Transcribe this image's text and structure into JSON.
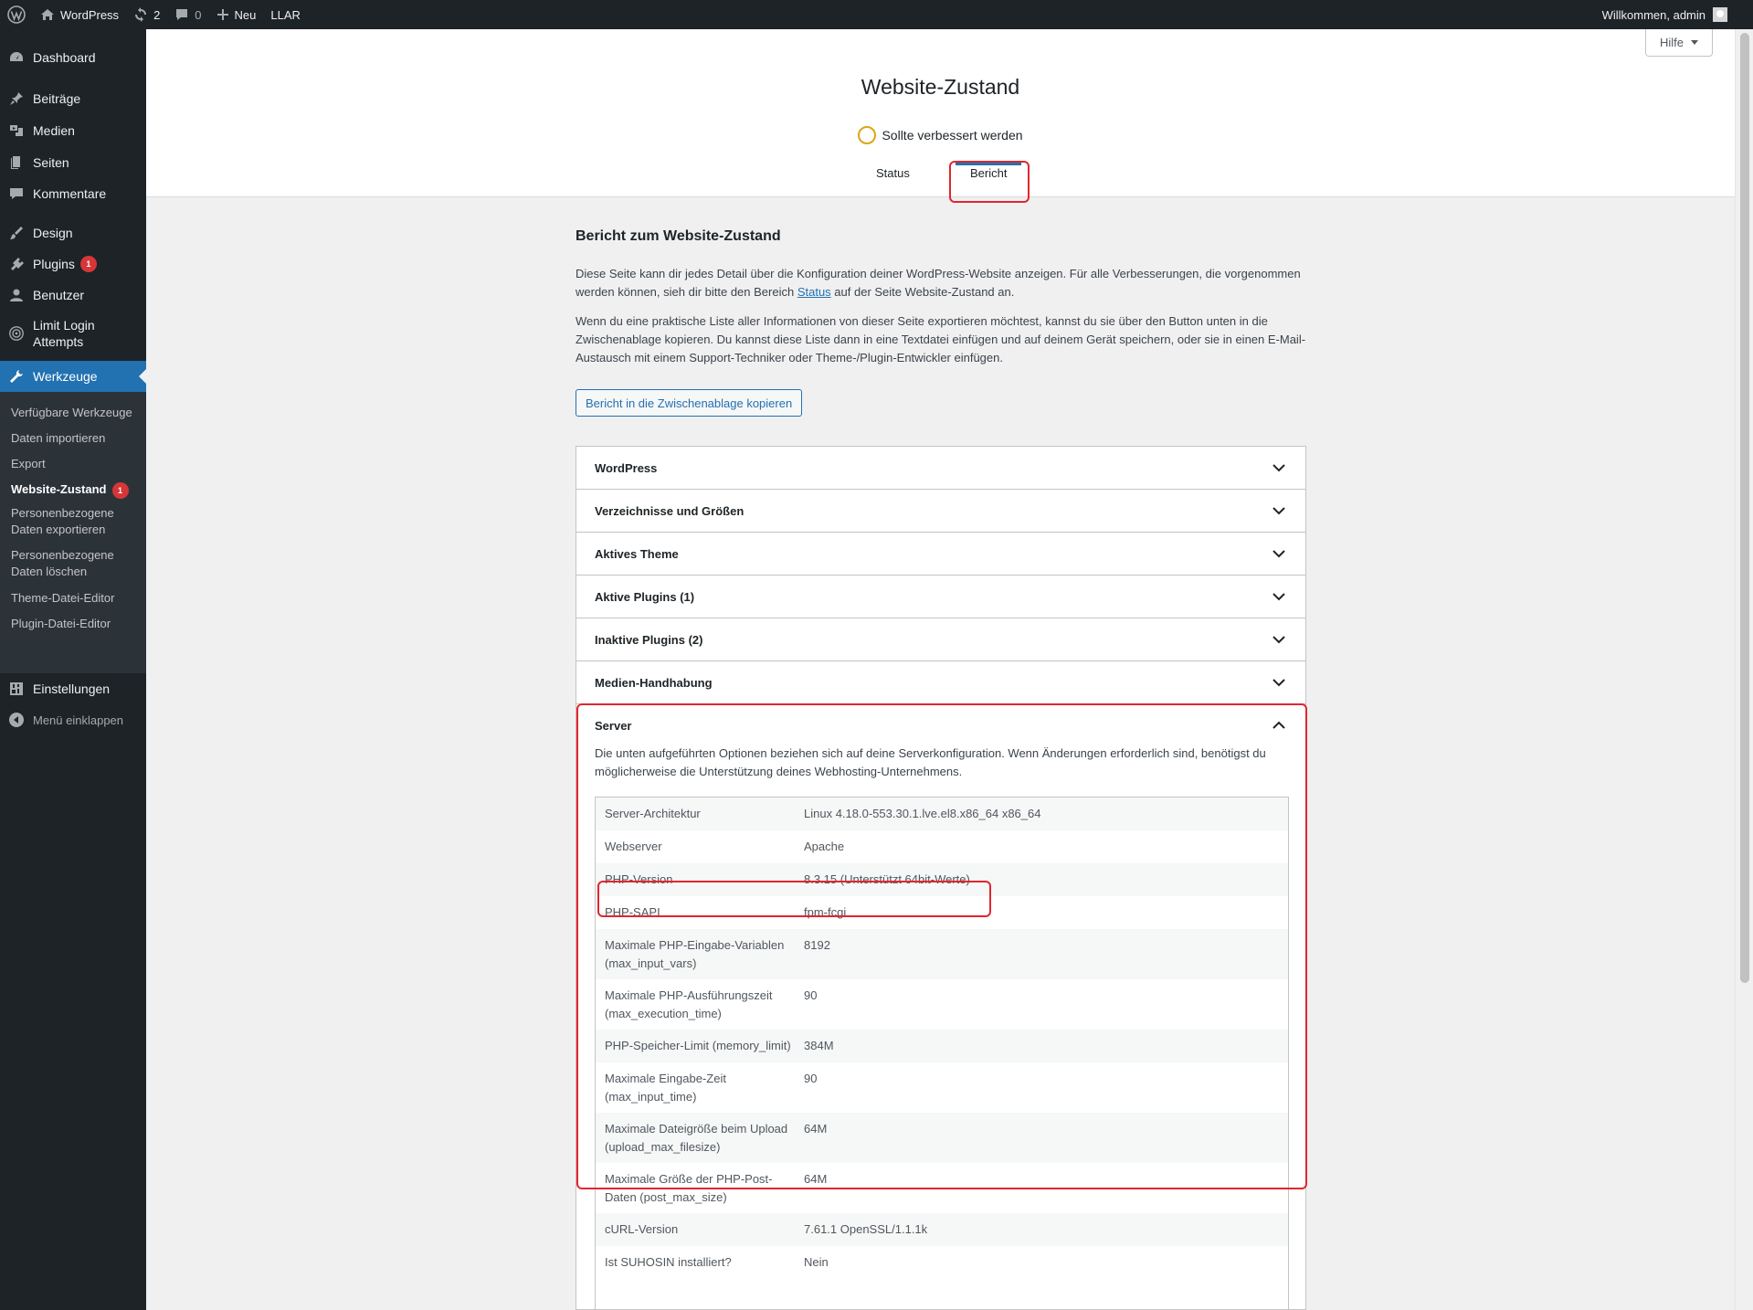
{
  "adminbar": {
    "site_name": "WordPress",
    "updates_count": "2",
    "comments_count": "0",
    "new_label": "Neu",
    "llar_label": "LLAR",
    "welcome": "Willkommen, admin"
  },
  "sidebar": {
    "items": [
      {
        "label": "Dashboard",
        "icon": "dashboard-icon"
      },
      {
        "label": "Beiträge",
        "icon": "pin-icon"
      },
      {
        "label": "Medien",
        "icon": "media-icon"
      },
      {
        "label": "Seiten",
        "icon": "pages-icon"
      },
      {
        "label": "Kommentare",
        "icon": "comment-icon"
      },
      {
        "label": "Design",
        "icon": "brush-icon"
      },
      {
        "label": "Plugins",
        "icon": "plugin-icon",
        "badge": "1"
      },
      {
        "label": "Benutzer",
        "icon": "user-icon"
      },
      {
        "label": "Limit Login",
        "label2": "Attempts",
        "icon": "llar-icon"
      },
      {
        "label": "Werkzeuge",
        "icon": "wrench-icon"
      },
      {
        "label": "Einstellungen",
        "icon": "settings-icon"
      },
      {
        "label": "Menü einklappen",
        "icon": "collapse-icon"
      }
    ],
    "submenu": [
      {
        "label": "Verfügbare Werkzeuge"
      },
      {
        "label": "Daten importieren"
      },
      {
        "label": "Export"
      },
      {
        "label": "Website-Zustand",
        "badge": "1"
      },
      {
        "label": "Personenbezogene",
        "label2": "Daten exportieren"
      },
      {
        "label": "Personenbezogene",
        "label2": "Daten löschen"
      },
      {
        "label": "Theme-Datei-Editor"
      },
      {
        "label": "Plugin-Datei-Editor"
      }
    ]
  },
  "header": {
    "help": "Hilfe",
    "title": "Website-Zustand",
    "status": "Sollte verbessert werden",
    "tabs": [
      "Status",
      "Bericht"
    ]
  },
  "report": {
    "heading": "Bericht zum Website-Zustand",
    "p1_line1": "Diese Seite kann dir jedes Detail über die Konfiguration deiner WordPress-Website anzeigen. Für alle Verbesserungen, die vorgenommen",
    "p1_line2_a": "werden können, sieh dir bitte den Bereich ",
    "p1_link": "Status",
    "p1_line2_b": " auf der Seite Website-Zustand an.",
    "p2_line1": "Wenn du eine praktische Liste aller Informationen von dieser Seite exportieren möchtest, kannst du sie über den Button unten in die",
    "p2_line2": "Zwischenablage kopieren. Du kannst diese Liste dann in eine Textdatei einfügen und auf deinem Gerät speichern, oder sie in einen E-Mail-",
    "p2_line3": "Austausch mit einem Support-Techniker oder Theme-/Plugin-Entwickler einfügen.",
    "copy_button": "Bericht in die Zwischenablage kopieren"
  },
  "accordion": {
    "sections": [
      "WordPress",
      "Verzeichnisse und Größen",
      "Aktives Theme",
      "Aktive Plugins (1)",
      "Inaktive Plugins (2)",
      "Medien-Handhabung",
      "Server"
    ],
    "server_desc_1": "Die unten aufgeführten Optionen beziehen sich auf deine Serverkonfiguration. Wenn Änderungen erforderlich sind, benötigst du",
    "server_desc_2": "möglicherweise die Unterstützung deines Webhosting-Unternehmens.",
    "rows": [
      {
        "k1": "Server-Architektur",
        "k2": "",
        "v": "Linux 4.18.0-553.30.1.lve.el8.x86_64 x86_64"
      },
      {
        "k1": "Webserver",
        "k2": "",
        "v": "Apache"
      },
      {
        "k1": "PHP-Version",
        "k2": "",
        "v": "8.3.15 (Unterstützt 64bit-Werte)"
      },
      {
        "k1": "PHP-SAPI",
        "k2": "",
        "v": "fpm-fcgi"
      },
      {
        "k1": "Maximale PHP-Eingabe-Variablen",
        "k2": "(max_input_vars)",
        "v": "8192"
      },
      {
        "k1": "Maximale PHP-Ausführungszeit",
        "k2": "(max_execution_time)",
        "v": "90"
      },
      {
        "k1": "PHP-Speicher-Limit (memory_limit)",
        "k2": "",
        "v": "384M"
      },
      {
        "k1": "Maximale Eingabe-Zeit",
        "k2": "(max_input_time)",
        "v": "90"
      },
      {
        "k1": "Maximale Dateigröße beim Upload",
        "k2": "(upload_max_filesize)",
        "v": "64M"
      },
      {
        "k1": "Maximale Größe der PHP-Post-",
        "k2": "Daten (post_max_size)",
        "v": "64M"
      },
      {
        "k1": "cURL-Version",
        "k2": "",
        "v": "7.61.1 OpenSSL/1.1.1k"
      },
      {
        "k1": "Ist SUHOSIN installiert?",
        "k2": "",
        "v": "Nein"
      }
    ]
  },
  "colors": {
    "accent": "#2271b1",
    "highlight": "#e1262f",
    "warning": "#dba617"
  }
}
